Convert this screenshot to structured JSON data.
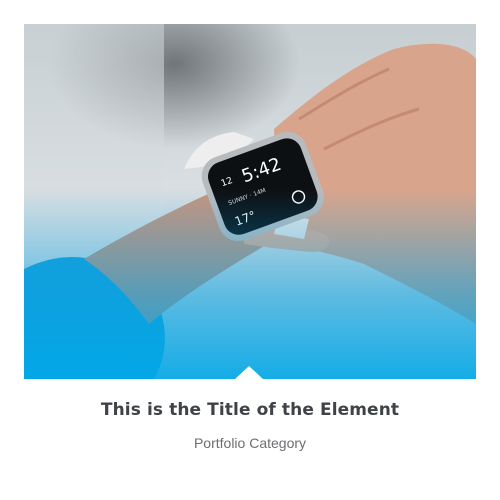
{
  "portfolio_item": {
    "image_alt": "Person checking time on a smartwatch",
    "title": "This is the Title of the Element",
    "category": "Portfolio Category"
  },
  "watch_screen": {
    "time_hour": "12",
    "time": "5:42",
    "info_line": "SUNNY · 14M",
    "temperature": "17°"
  },
  "colors": {
    "accent_overlay": "#00A8E8",
    "sleeve": "#1d9fd9",
    "title_text": "#3f4246",
    "category_text": "#6b6e72"
  },
  "icons": {
    "pointer_notch": "triangle-up"
  }
}
